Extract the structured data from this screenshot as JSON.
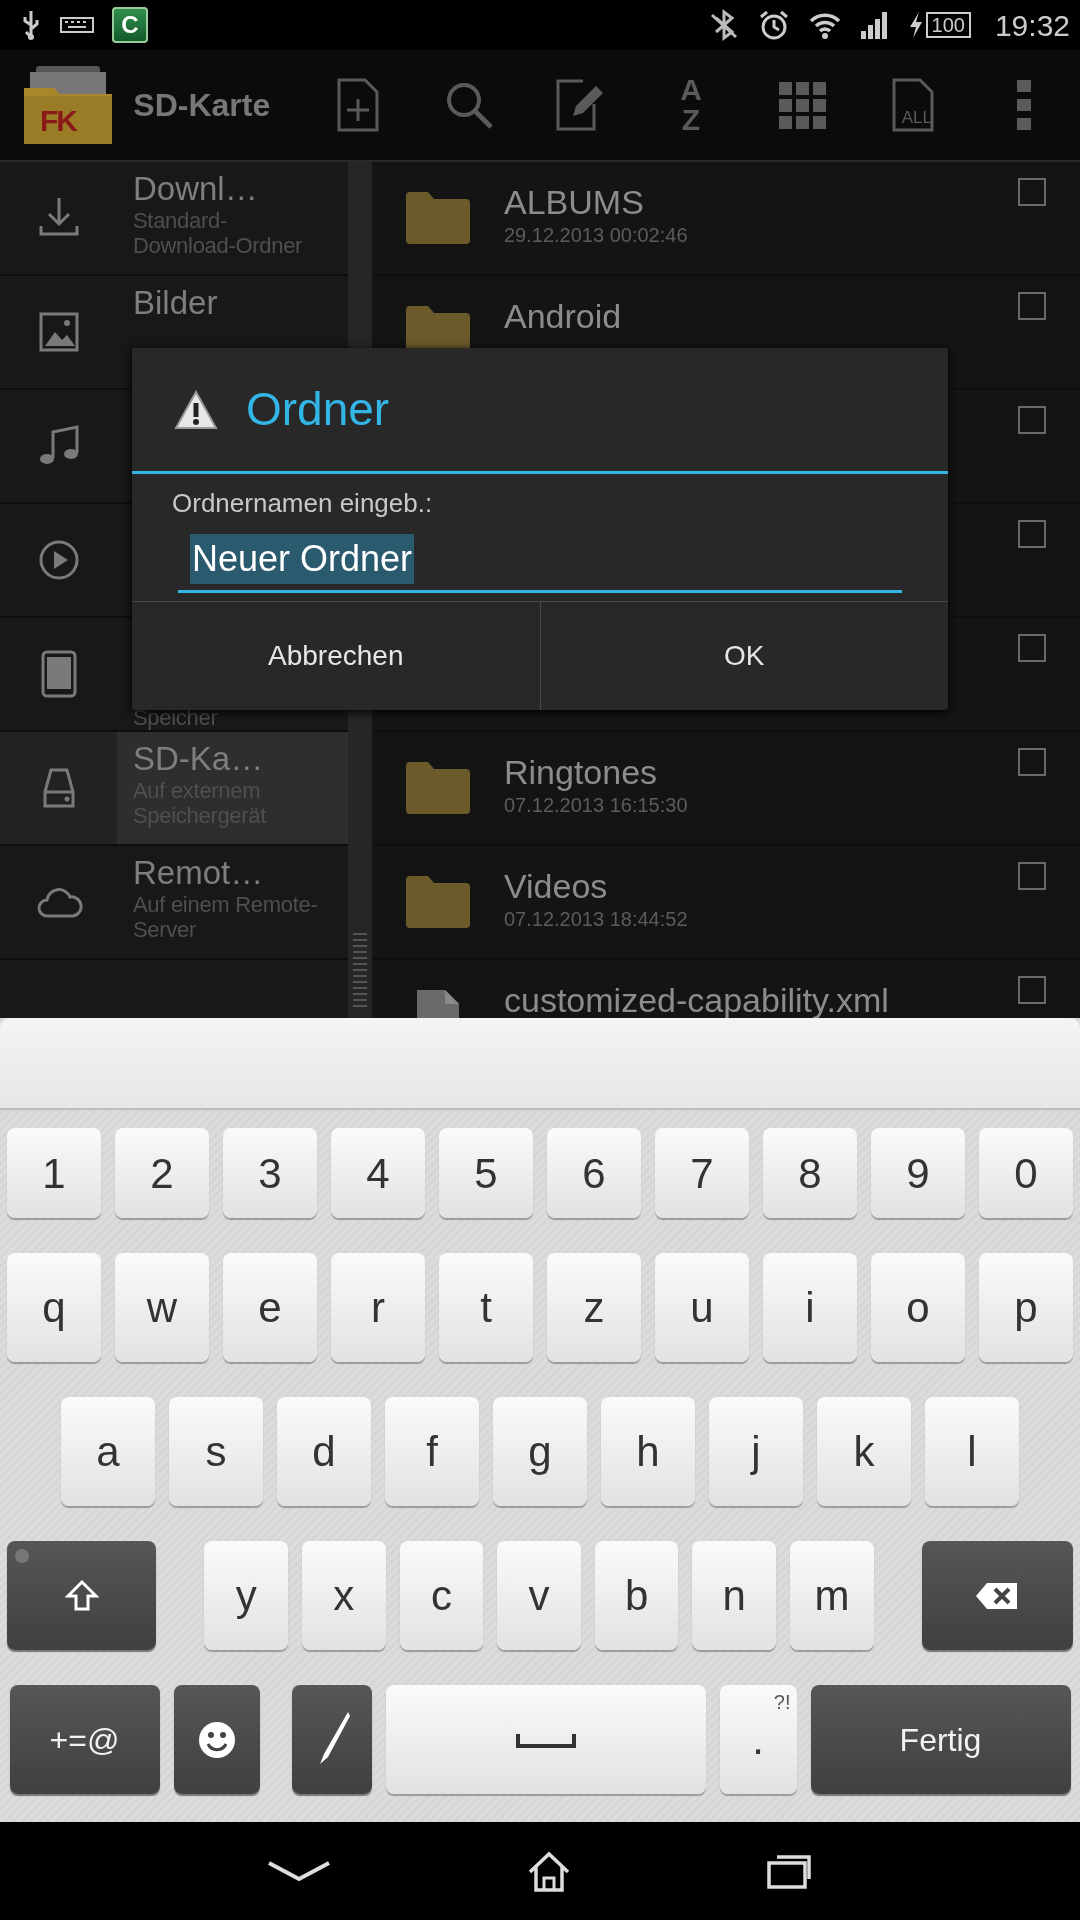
{
  "status_bar": {
    "app_icon_letter": "C",
    "battery": "100",
    "time": "19:32"
  },
  "action_bar": {
    "logo_text": "FK",
    "title": "SD-Karte",
    "sort_letters": [
      "A",
      "Z"
    ],
    "select_all_label": "ALL"
  },
  "sidebar": {
    "items": [
      {
        "title": "Downl…",
        "subtitle": "Standard-Download-Ordner",
        "selected": false
      },
      {
        "title": "Bilder",
        "selected": false
      },
      {
        "selected": false
      },
      {
        "selected": false
      },
      {
        "subtitle": "Speicher",
        "selected": false
      },
      {
        "title": "SD-Ka…",
        "subtitle": "Auf externem Speichergerät",
        "selected": true
      },
      {
        "title": "Remot…",
        "subtitle": "Auf einem Remote-Server",
        "selected": false
      }
    ]
  },
  "files": [
    {
      "kind": "folder",
      "name": "ALBUMS",
      "date": "29.12.2013 00:02:46",
      "checked": false
    },
    {
      "kind": "folder",
      "name": "Android",
      "checked": false
    },
    {
      "checked": false
    },
    {
      "checked": false
    },
    {
      "checked": false
    },
    {
      "kind": "folder",
      "name": "Ringtones",
      "date": "07.12.2013 16:15:30",
      "checked": false
    },
    {
      "kind": "folder",
      "name": "Videos",
      "date": "07.12.2013 18:44:52",
      "checked": false
    },
    {
      "kind": "file",
      "name": "customized-capability.xml",
      "checked": false
    }
  ],
  "dialog": {
    "title": "Ordner",
    "label": "Ordnernamen eingeb.:",
    "value": "Neuer Ordner",
    "buttons": [
      "Abbrechen",
      "OK"
    ]
  },
  "keyboard": {
    "rows": [
      {
        "keys": [
          {
            "kind": "char",
            "label": "1"
          },
          {
            "kind": "char",
            "label": "2"
          },
          {
            "kind": "char",
            "label": "3"
          },
          {
            "kind": "char",
            "label": "4"
          },
          {
            "kind": "char",
            "label": "5"
          },
          {
            "kind": "char",
            "label": "6"
          },
          {
            "kind": "char",
            "label": "7"
          },
          {
            "kind": "char",
            "label": "8"
          },
          {
            "kind": "char",
            "label": "9"
          },
          {
            "kind": "char",
            "label": "0"
          }
        ]
      },
      {
        "keys": [
          {
            "kind": "char",
            "label": "q"
          },
          {
            "kind": "char",
            "label": "w"
          },
          {
            "kind": "char",
            "label": "e"
          },
          {
            "kind": "char",
            "label": "r"
          },
          {
            "kind": "char",
            "label": "t"
          },
          {
            "kind": "char",
            "label": "z"
          },
          {
            "kind": "char",
            "label": "u"
          },
          {
            "kind": "char",
            "label": "i"
          },
          {
            "kind": "char",
            "label": "o"
          },
          {
            "kind": "char",
            "label": "p"
          }
        ]
      },
      {
        "keys": [
          {
            "kind": "char",
            "label": "a"
          },
          {
            "kind": "char",
            "label": "s"
          },
          {
            "kind": "char",
            "label": "d"
          },
          {
            "kind": "char",
            "label": "f"
          },
          {
            "kind": "char",
            "label": "g"
          },
          {
            "kind": "char",
            "label": "h"
          },
          {
            "kind": "char",
            "label": "j"
          },
          {
            "kind": "char",
            "label": "k"
          },
          {
            "kind": "char",
            "label": "l"
          }
        ]
      },
      {
        "keys": [
          {
            "kind": "shift",
            "locked": false
          },
          {
            "kind": "char",
            "label": "y"
          },
          {
            "kind": "char",
            "label": "x"
          },
          {
            "kind": "char",
            "label": "c"
          },
          {
            "kind": "char",
            "label": "v"
          },
          {
            "kind": "char",
            "label": "b"
          },
          {
            "kind": "char",
            "label": "n"
          },
          {
            "kind": "char",
            "label": "m"
          },
          {
            "kind": "backspace"
          }
        ]
      },
      {
        "keys": [
          {
            "kind": "symbols",
            "label": "+=@"
          },
          {
            "kind": "emoji"
          },
          {
            "kind": "pen"
          },
          {
            "kind": "space"
          },
          {
            "kind": "period",
            "label": ".",
            "hint": "?!"
          },
          {
            "kind": "done",
            "label": "Fertig"
          }
        ]
      }
    ]
  }
}
